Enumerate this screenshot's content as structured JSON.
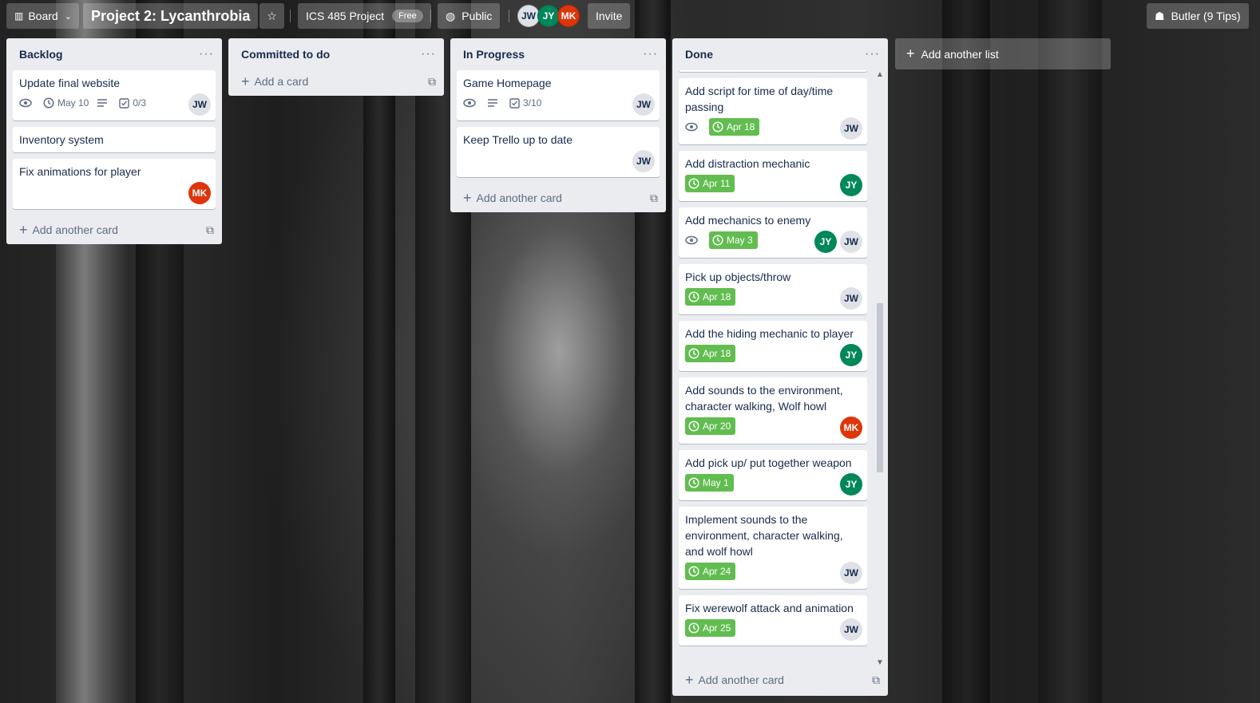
{
  "header": {
    "board_switch_label": "Board",
    "board_title": "Project 2: Lycanthrobia",
    "team_label": "ICS 485 Project",
    "team_plan": "Free",
    "visibility_label": "Public",
    "members": [
      "JW",
      "JY",
      "MK"
    ],
    "invite_label": "Invite",
    "butler_label": "Butler (9 Tips)"
  },
  "lists": [
    {
      "title": "Backlog",
      "add_label": "Add another card",
      "cards": [
        {
          "title": "Update final website",
          "due": "May 10",
          "checklist": "0/3",
          "members": [
            "JW"
          ]
        },
        {
          "title": "Inventory system"
        },
        {
          "title": "Fix animations for player",
          "members": [
            "MK"
          ]
        }
      ]
    },
    {
      "title": "Committed to do",
      "add_label": "Add a card",
      "cards": []
    },
    {
      "title": "In Progress",
      "add_label": "Add another card",
      "cards": [
        {
          "title": "Game Homepage",
          "checklist": "3/10",
          "members": [
            "JW"
          ]
        },
        {
          "title": "Keep Trello up to date",
          "members": [
            "JW"
          ]
        }
      ]
    },
    {
      "title": "Done",
      "add_label": "Add another card",
      "cards": [
        {
          "title": "Add script for time of day/time passing",
          "due": "Apr 18",
          "members": [
            "JW"
          ]
        },
        {
          "title": "Add distraction mechanic",
          "due": "Apr 11",
          "members": [
            "JY"
          ]
        },
        {
          "title": "Add mechanics to enemy",
          "due": "May 3",
          "members": [
            "JY",
            "JW"
          ]
        },
        {
          "title": "Pick up objects/throw",
          "due": "Apr 18",
          "members": [
            "JW"
          ]
        },
        {
          "title": "Add the hiding mechanic to player",
          "due": "Apr 18",
          "members": [
            "JY"
          ]
        },
        {
          "title": "Add sounds to the environment, character walking, Wolf howl",
          "due": "Apr 20",
          "members": [
            "MK"
          ]
        },
        {
          "title": "Add pick up/ put together weapon",
          "due": "May 1",
          "members": [
            "JY"
          ]
        },
        {
          "title": "Implement sounds to the environment, character walking, and wolf howl",
          "due": "Apr 24",
          "members": [
            "JW"
          ]
        },
        {
          "title": "Fix werewolf attack and animation",
          "due": "Apr 25",
          "members": [
            "JW"
          ]
        }
      ]
    }
  ],
  "add_list_label": "Add another list",
  "colors": {
    "due_complete": "#61bd4f",
    "member_jy": "#00875a",
    "member_mk": "#de350b",
    "member_jw": "#dfe1e6",
    "list_bg": "#ebecf0"
  }
}
